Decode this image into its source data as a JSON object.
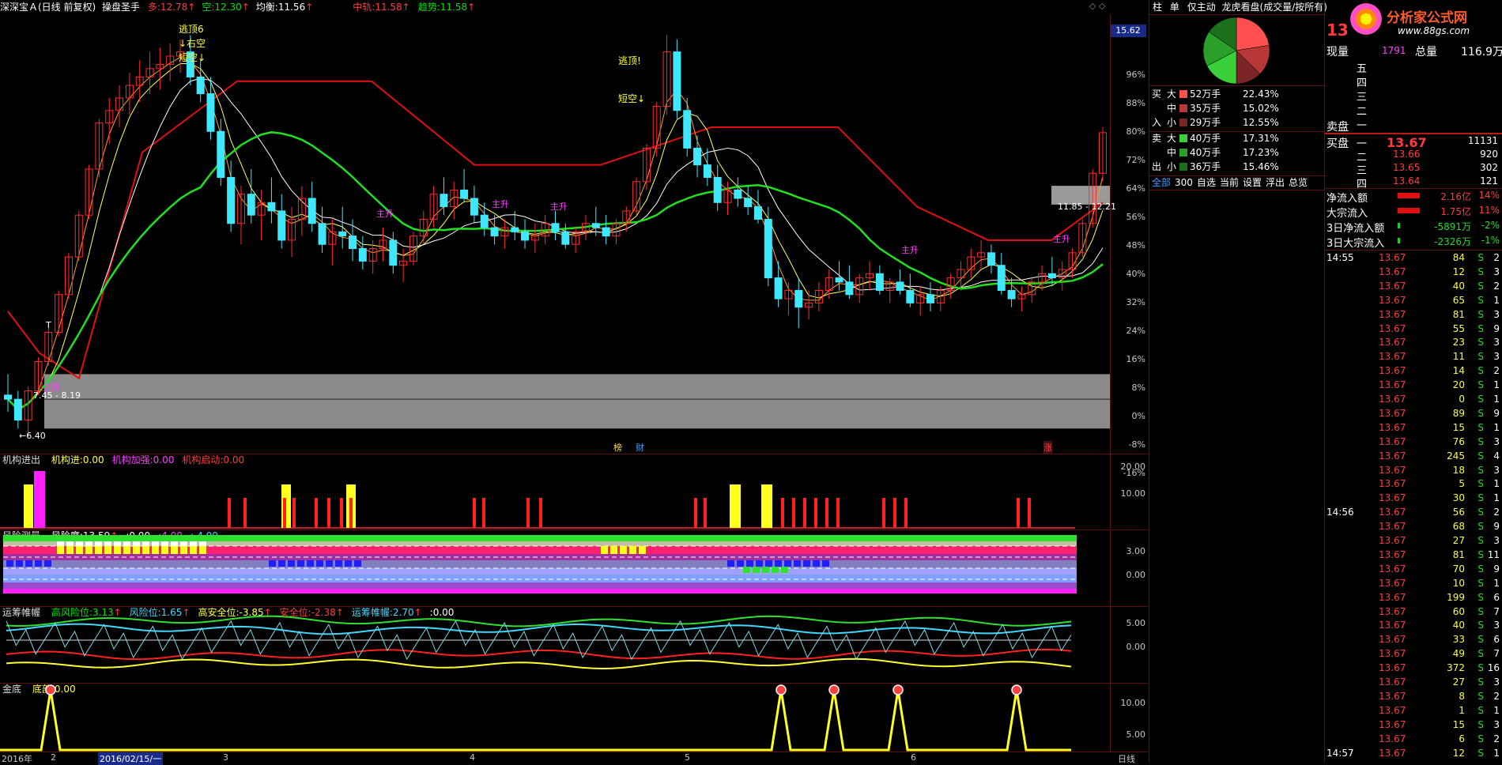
{
  "header": {
    "stock": "深深宝Ａ(日线 前复权)",
    "indicator": "操盘圣手",
    "items": [
      {
        "label": "多:",
        "value": "12.78",
        "arrow": "↑",
        "color": "#ff3c3c"
      },
      {
        "label": "空:",
        "value": "12.30",
        "arrow": "↑",
        "color": "#00e000"
      },
      {
        "label": "均衡:",
        "value": "11.56",
        "arrow": "↑",
        "color": "#ffffff"
      },
      {
        "label": "中轨:",
        "value": "11.58",
        "arrow": "↑",
        "color": "#ff3c3c"
      },
      {
        "label": "趋势:",
        "value": "11.58",
        "arrow": "↑",
        "color": "#00e000"
      }
    ],
    "price_box": "15.62"
  },
  "main_axis": [
    "96%",
    "88%",
    "80%",
    "72%",
    "64%",
    "56%",
    "48%",
    "40%",
    "32%",
    "24%",
    "16%",
    "8%",
    "0%",
    "-8%",
    "-16%"
  ],
  "annotations": {
    "top1_a": "逃顶6",
    "top1_b": "↓右空",
    "top1_c": "短空↓",
    "top2_a": "逃顶!",
    "top2_b": "短空↓",
    "low_label": "7.45 - 8.19",
    "low_price": "←6.40",
    "hi_label": "11.85 - 12.21",
    "rise": "主升",
    "marker1": "榜",
    "marker2": "财",
    "marker3": "涨",
    "t_mark": "T"
  },
  "pane1": {
    "title": "机构进出",
    "items": [
      {
        "label": "机构进:",
        "value": "0.00",
        "color": "#ffff40"
      },
      {
        "label": "机构加强:",
        "value": "0.00",
        "color": "#ff40ff"
      },
      {
        "label": "机构启动:",
        "value": "0.00",
        "color": "#ff3c3c"
      }
    ],
    "axis": [
      "20.00",
      "10.00"
    ]
  },
  "pane2": {
    "title": "风险测量",
    "items": [
      {
        "label": "风险度:",
        "value": "13.59",
        "arrow": "↑",
        "color": "#ffffff"
      },
      {
        "label": ":",
        "value": "0.00",
        "color": "#ffffff"
      },
      {
        "label": ":",
        "value": "4.00",
        "color": "#ff40ff"
      },
      {
        "label": ":",
        "value": "-4.00",
        "color": "#40d8ff"
      }
    ],
    "axis": [
      "3.00",
      "0.00"
    ]
  },
  "pane3": {
    "title": "运筹帷幄",
    "items": [
      {
        "label": "高风险位:",
        "value": "3.13",
        "arrow": "↑",
        "color": "#00e000"
      },
      {
        "label": "风险位:",
        "value": "1.65",
        "arrow": "↑",
        "color": "#40d8ff"
      },
      {
        "label": "高安全位:",
        "value": "-3.85",
        "arrow": "↑",
        "color": "#ffff40"
      },
      {
        "label": "安全位:",
        "value": "-2.38",
        "arrow": "↑",
        "color": "#ff3c3c"
      },
      {
        "label": "运筹帷幄:",
        "value": "2.70",
        "arrow": "↑",
        "color": "#40d8ff"
      },
      {
        "label": ":",
        "value": "0.00",
        "color": "#ffffff"
      }
    ],
    "axis": [
      "5.00",
      "0.00"
    ]
  },
  "pane4": {
    "title": "金底",
    "items": [
      {
        "label": "底部:",
        "value": "0.00",
        "color": "#ffff40"
      }
    ],
    "axis": [
      "10.00",
      "5.00"
    ]
  },
  "xaxis": {
    "items": [
      "2016年",
      "2",
      "2016/02/15/一",
      "3",
      "4",
      "5",
      "6"
    ],
    "right": "日线"
  },
  "right_panel": {
    "tabs": [
      "柱",
      "单",
      "仅主动",
      "龙虎看盘(成交量/按所有)"
    ],
    "logo": "分析家公式网",
    "logo_url": "www.88gs.com",
    "buy_rows": [
      {
        "side": "买",
        "size": "大",
        "vol": "52万手",
        "pct": "22.43%",
        "color": "#ff5050"
      },
      {
        "side": "",
        "size": "中",
        "vol": "35万手",
        "pct": "15.02%",
        "color": "#b83838"
      },
      {
        "side": "入",
        "size": "小",
        "vol": "29万手",
        "pct": "12.55%",
        "color": "#7a2626"
      }
    ],
    "sell_rows": [
      {
        "side": "卖",
        "size": "大",
        "vol": "40万手",
        "pct": "17.31%",
        "color": "#3ad03a"
      },
      {
        "side": "",
        "size": "中",
        "vol": "40万手",
        "pct": "17.23%",
        "color": "#2aa02a"
      },
      {
        "side": "出",
        "size": "小",
        "vol": "36万手",
        "pct": "15.46%",
        "color": "#1c701c"
      }
    ],
    "bottom_tabs": [
      "全部",
      "300",
      "自选",
      "当前",
      "设置",
      "浮出",
      "总览"
    ]
  },
  "quote": {
    "code_partial": "13",
    "xianliang_label": "现量",
    "xianliang": "1791",
    "zongliang_label": "总量",
    "zongliang": "116.9万",
    "sell_levels": [
      "五",
      "四",
      "三",
      "二",
      "一"
    ],
    "sell_label": "卖盘",
    "buy_label": "买盘",
    "buy_levels": [
      {
        "lvl": "一",
        "price": "13.67",
        "vol": "11131"
      },
      {
        "lvl": "二",
        "price": "13.66",
        "vol": "920"
      },
      {
        "lvl": "三",
        "price": "13.65",
        "vol": "302"
      },
      {
        "lvl": "四",
        "price": "13.64",
        "vol": "121"
      }
    ],
    "flows": [
      {
        "label": "净流入额",
        "value": "2.16亿",
        "pct": "14%",
        "bar": true
      },
      {
        "label": "大宗流入",
        "value": "1.75亿",
        "pct": "11%",
        "bar": true
      },
      {
        "label": "3日净流入额",
        "value": "-5891万",
        "pct": "-2%",
        "bar": false
      },
      {
        "label": "3日大宗流入",
        "value": "-2326万",
        "pct": "-1%",
        "bar": false
      }
    ]
  },
  "ticks": [
    {
      "time": "14:55",
      "price": "13.67",
      "vol": "84",
      "bs": "S",
      "n": "2"
    },
    {
      "time": "",
      "price": "13.67",
      "vol": "12",
      "bs": "S",
      "n": "3"
    },
    {
      "time": "",
      "price": "13.67",
      "vol": "40",
      "bs": "S",
      "n": "2"
    },
    {
      "time": "",
      "price": "13.67",
      "vol": "65",
      "bs": "S",
      "n": "1"
    },
    {
      "time": "",
      "price": "13.67",
      "vol": "81",
      "bs": "S",
      "n": "3"
    },
    {
      "time": "",
      "price": "13.67",
      "vol": "55",
      "bs": "S",
      "n": "9"
    },
    {
      "time": "",
      "price": "13.67",
      "vol": "23",
      "bs": "S",
      "n": "3"
    },
    {
      "time": "",
      "price": "13.67",
      "vol": "11",
      "bs": "S",
      "n": "3"
    },
    {
      "time": "",
      "price": "13.67",
      "vol": "14",
      "bs": "S",
      "n": "2"
    },
    {
      "time": "",
      "price": "13.67",
      "vol": "20",
      "bs": "S",
      "n": "1"
    },
    {
      "time": "",
      "price": "13.67",
      "vol": "0",
      "bs": "S",
      "n": "1"
    },
    {
      "time": "",
      "price": "13.67",
      "vol": "89",
      "bs": "S",
      "n": "9"
    },
    {
      "time": "",
      "price": "13.67",
      "vol": "15",
      "bs": "S",
      "n": "1"
    },
    {
      "time": "",
      "price": "13.67",
      "vol": "76",
      "bs": "S",
      "n": "3"
    },
    {
      "time": "",
      "price": "13.67",
      "vol": "245",
      "bs": "S",
      "n": "4"
    },
    {
      "time": "",
      "price": "13.67",
      "vol": "18",
      "bs": "S",
      "n": "3"
    },
    {
      "time": "",
      "price": "13.67",
      "vol": "5",
      "bs": "S",
      "n": "1"
    },
    {
      "time": "",
      "price": "13.67",
      "vol": "30",
      "bs": "S",
      "n": "1"
    },
    {
      "time": "14:56",
      "price": "13.67",
      "vol": "56",
      "bs": "S",
      "n": "2"
    },
    {
      "time": "",
      "price": "13.67",
      "vol": "68",
      "bs": "S",
      "n": "9"
    },
    {
      "time": "",
      "price": "13.67",
      "vol": "27",
      "bs": "S",
      "n": "3"
    },
    {
      "time": "",
      "price": "13.67",
      "vol": "81",
      "bs": "S",
      "n": "11"
    },
    {
      "time": "",
      "price": "13.67",
      "vol": "70",
      "bs": "S",
      "n": "9"
    },
    {
      "time": "",
      "price": "13.67",
      "vol": "10",
      "bs": "S",
      "n": "1"
    },
    {
      "time": "",
      "price": "13.67",
      "vol": "199",
      "bs": "S",
      "n": "6"
    },
    {
      "time": "",
      "price": "13.67",
      "vol": "60",
      "bs": "S",
      "n": "7"
    },
    {
      "time": "",
      "price": "13.67",
      "vol": "40",
      "bs": "S",
      "n": "3"
    },
    {
      "time": "",
      "price": "13.67",
      "vol": "33",
      "bs": "S",
      "n": "6"
    },
    {
      "time": "",
      "price": "13.67",
      "vol": "49",
      "bs": "S",
      "n": "7"
    },
    {
      "time": "",
      "price": "13.67",
      "vol": "372",
      "bs": "S",
      "n": "16"
    },
    {
      "time": "",
      "price": "13.67",
      "vol": "27",
      "bs": "S",
      "n": "3"
    },
    {
      "time": "",
      "price": "13.67",
      "vol": "8",
      "bs": "S",
      "n": "2"
    },
    {
      "time": "",
      "price": "13.67",
      "vol": "1",
      "bs": "S",
      "n": "1"
    },
    {
      "time": "",
      "price": "13.67",
      "vol": "15",
      "bs": "S",
      "n": "3"
    },
    {
      "time": "",
      "price": "13.67",
      "vol": "6",
      "bs": "S",
      "n": "2"
    },
    {
      "time": "14:57",
      "price": "13.67",
      "vol": "12",
      "bs": "S",
      "n": "1"
    }
  ],
  "chart_data": {
    "type": "candlestick",
    "title": "深深宝Ａ(日线 前复权)",
    "candles": [
      [
        7.4,
        7.9,
        7.0,
        7.3
      ],
      [
        7.3,
        7.5,
        6.6,
        6.8
      ],
      [
        6.8,
        7.6,
        6.4,
        7.5
      ],
      [
        7.5,
        8.3,
        7.4,
        8.2
      ],
      [
        8.2,
        9.0,
        8.1,
        8.9
      ],
      [
        8.9,
        9.9,
        8.8,
        9.8
      ],
      [
        9.8,
        10.8,
        9.7,
        10.7
      ],
      [
        10.7,
        11.8,
        10.6,
        11.7
      ],
      [
        11.7,
        12.9,
        11.6,
        12.8
      ],
      [
        12.8,
        14.0,
        12.6,
        13.9
      ],
      [
        13.9,
        14.5,
        13.4,
        14.2
      ],
      [
        14.2,
        14.8,
        13.8,
        14.5
      ],
      [
        14.5,
        15.1,
        14.1,
        14.8
      ],
      [
        14.8,
        15.4,
        14.4,
        15.0
      ],
      [
        15.0,
        15.6,
        14.6,
        15.2
      ],
      [
        15.2,
        15.7,
        14.7,
        15.3
      ],
      [
        15.3,
        15.8,
        14.9,
        15.5
      ],
      [
        15.5,
        15.9,
        15.1,
        15.6
      ],
      [
        15.6,
        16.0,
        14.8,
        15.0
      ],
      [
        15.0,
        15.4,
        14.4,
        14.6
      ],
      [
        14.6,
        15.0,
        13.5,
        13.7
      ],
      [
        13.7,
        14.0,
        12.4,
        12.6
      ],
      [
        12.6,
        13.0,
        11.3,
        11.5
      ],
      [
        11.5,
        12.4,
        11.0,
        12.2
      ],
      [
        12.2,
        12.8,
        11.5,
        11.7
      ],
      [
        11.7,
        12.3,
        11.1,
        12.0
      ],
      [
        12.0,
        12.6,
        11.5,
        11.8
      ],
      [
        11.8,
        12.2,
        10.9,
        11.1
      ],
      [
        11.1,
        11.9,
        10.7,
        11.6
      ],
      [
        11.6,
        12.4,
        11.2,
        12.1
      ],
      [
        12.1,
        12.5,
        11.3,
        11.5
      ],
      [
        11.5,
        11.9,
        10.8,
        11.0
      ],
      [
        11.0,
        11.6,
        10.5,
        11.3
      ],
      [
        11.3,
        11.9,
        10.9,
        11.2
      ],
      [
        11.2,
        11.6,
        10.6,
        10.9
      ],
      [
        10.9,
        11.2,
        10.4,
        10.6
      ],
      [
        10.6,
        11.1,
        10.3,
        10.9
      ],
      [
        10.9,
        11.4,
        10.6,
        11.1
      ],
      [
        11.1,
        11.3,
        10.3,
        10.5
      ],
      [
        10.5,
        10.9,
        10.1,
        10.6
      ],
      [
        10.6,
        11.3,
        10.5,
        11.2
      ],
      [
        11.2,
        11.8,
        11.0,
        11.6
      ],
      [
        11.6,
        12.4,
        11.4,
        12.2
      ],
      [
        12.2,
        12.6,
        11.7,
        11.9
      ],
      [
        11.9,
        12.5,
        11.6,
        12.3
      ],
      [
        12.3,
        12.8,
        12.0,
        12.1
      ],
      [
        12.1,
        12.4,
        11.5,
        11.7
      ],
      [
        11.7,
        12.0,
        11.2,
        11.4
      ],
      [
        11.4,
        11.7,
        11.0,
        11.2
      ],
      [
        11.2,
        11.6,
        10.9,
        11.4
      ],
      [
        11.4,
        11.8,
        11.1,
        11.3
      ],
      [
        11.3,
        11.6,
        10.9,
        11.1
      ],
      [
        11.1,
        11.5,
        10.8,
        11.2
      ],
      [
        11.2,
        11.7,
        11.0,
        11.5
      ],
      [
        11.5,
        11.8,
        11.1,
        11.3
      ],
      [
        11.3,
        11.5,
        10.9,
        11.0
      ],
      [
        11.0,
        11.4,
        10.8,
        11.3
      ],
      [
        11.3,
        11.7,
        11.1,
        11.5
      ],
      [
        11.5,
        11.9,
        11.2,
        11.4
      ],
      [
        11.4,
        11.7,
        11.0,
        11.2
      ],
      [
        11.2,
        11.6,
        11.0,
        11.5
      ],
      [
        11.5,
        11.9,
        11.3,
        11.8
      ],
      [
        11.8,
        12.6,
        11.7,
        12.5
      ],
      [
        12.5,
        13.4,
        12.3,
        13.3
      ],
      [
        13.3,
        14.4,
        13.1,
        14.3
      ],
      [
        14.3,
        16.0,
        14.1,
        15.6
      ],
      [
        15.6,
        15.9,
        14.0,
        14.2
      ],
      [
        14.2,
        14.5,
        13.1,
        13.3
      ],
      [
        13.3,
        13.6,
        12.6,
        12.9
      ],
      [
        12.9,
        13.3,
        12.4,
        12.6
      ],
      [
        12.6,
        12.9,
        11.8,
        12.0
      ],
      [
        12.0,
        12.5,
        11.7,
        12.3
      ],
      [
        12.3,
        12.6,
        11.9,
        12.1
      ],
      [
        12.1,
        12.4,
        11.7,
        11.9
      ],
      [
        11.9,
        12.3,
        11.5,
        11.6
      ],
      [
        11.6,
        11.9,
        10.0,
        10.2
      ],
      [
        10.2,
        10.6,
        9.5,
        9.7
      ],
      [
        9.7,
        10.1,
        9.3,
        9.9
      ],
      [
        9.9,
        10.2,
        9.0,
        9.5
      ],
      [
        9.5,
        9.9,
        9.2,
        9.6
      ],
      [
        9.6,
        10.1,
        9.4,
        9.9
      ],
      [
        9.9,
        10.4,
        9.7,
        10.2
      ],
      [
        10.2,
        10.6,
        9.9,
        10.1
      ],
      [
        10.1,
        10.5,
        9.7,
        9.8
      ],
      [
        9.8,
        10.3,
        9.6,
        10.2
      ],
      [
        10.2,
        10.6,
        9.9,
        10.3
      ],
      [
        10.3,
        10.5,
        9.8,
        9.9
      ],
      [
        9.9,
        10.2,
        9.6,
        10.1
      ],
      [
        10.1,
        10.4,
        9.8,
        9.9
      ],
      [
        9.9,
        10.3,
        9.5,
        9.6
      ],
      [
        9.6,
        10.0,
        9.3,
        9.8
      ],
      [
        9.8,
        10.1,
        9.4,
        9.6
      ],
      [
        9.6,
        10.0,
        9.4,
        9.9
      ],
      [
        9.9,
        10.3,
        9.7,
        10.2
      ],
      [
        10.2,
        10.6,
        9.9,
        10.4
      ],
      [
        10.4,
        10.9,
        10.2,
        10.7
      ],
      [
        10.7,
        11.1,
        10.4,
        10.8
      ],
      [
        10.8,
        11.0,
        10.3,
        10.5
      ],
      [
        10.5,
        10.8,
        9.8,
        9.9
      ],
      [
        9.9,
        10.2,
        9.5,
        9.7
      ],
      [
        9.7,
        10.0,
        9.4,
        9.8
      ],
      [
        9.8,
        10.2,
        9.6,
        10.1
      ],
      [
        10.1,
        10.5,
        9.9,
        10.3
      ],
      [
        10.3,
        10.7,
        10.0,
        10.2
      ],
      [
        10.2,
        10.6,
        9.9,
        10.4
      ],
      [
        10.4,
        10.9,
        10.2,
        10.8
      ],
      [
        10.8,
        11.6,
        10.7,
        11.5
      ],
      [
        11.5,
        12.8,
        11.4,
        12.7
      ],
      [
        12.7,
        13.8,
        12.5,
        13.67
      ]
    ],
    "ylim": [
      6.0,
      16.5
    ]
  }
}
